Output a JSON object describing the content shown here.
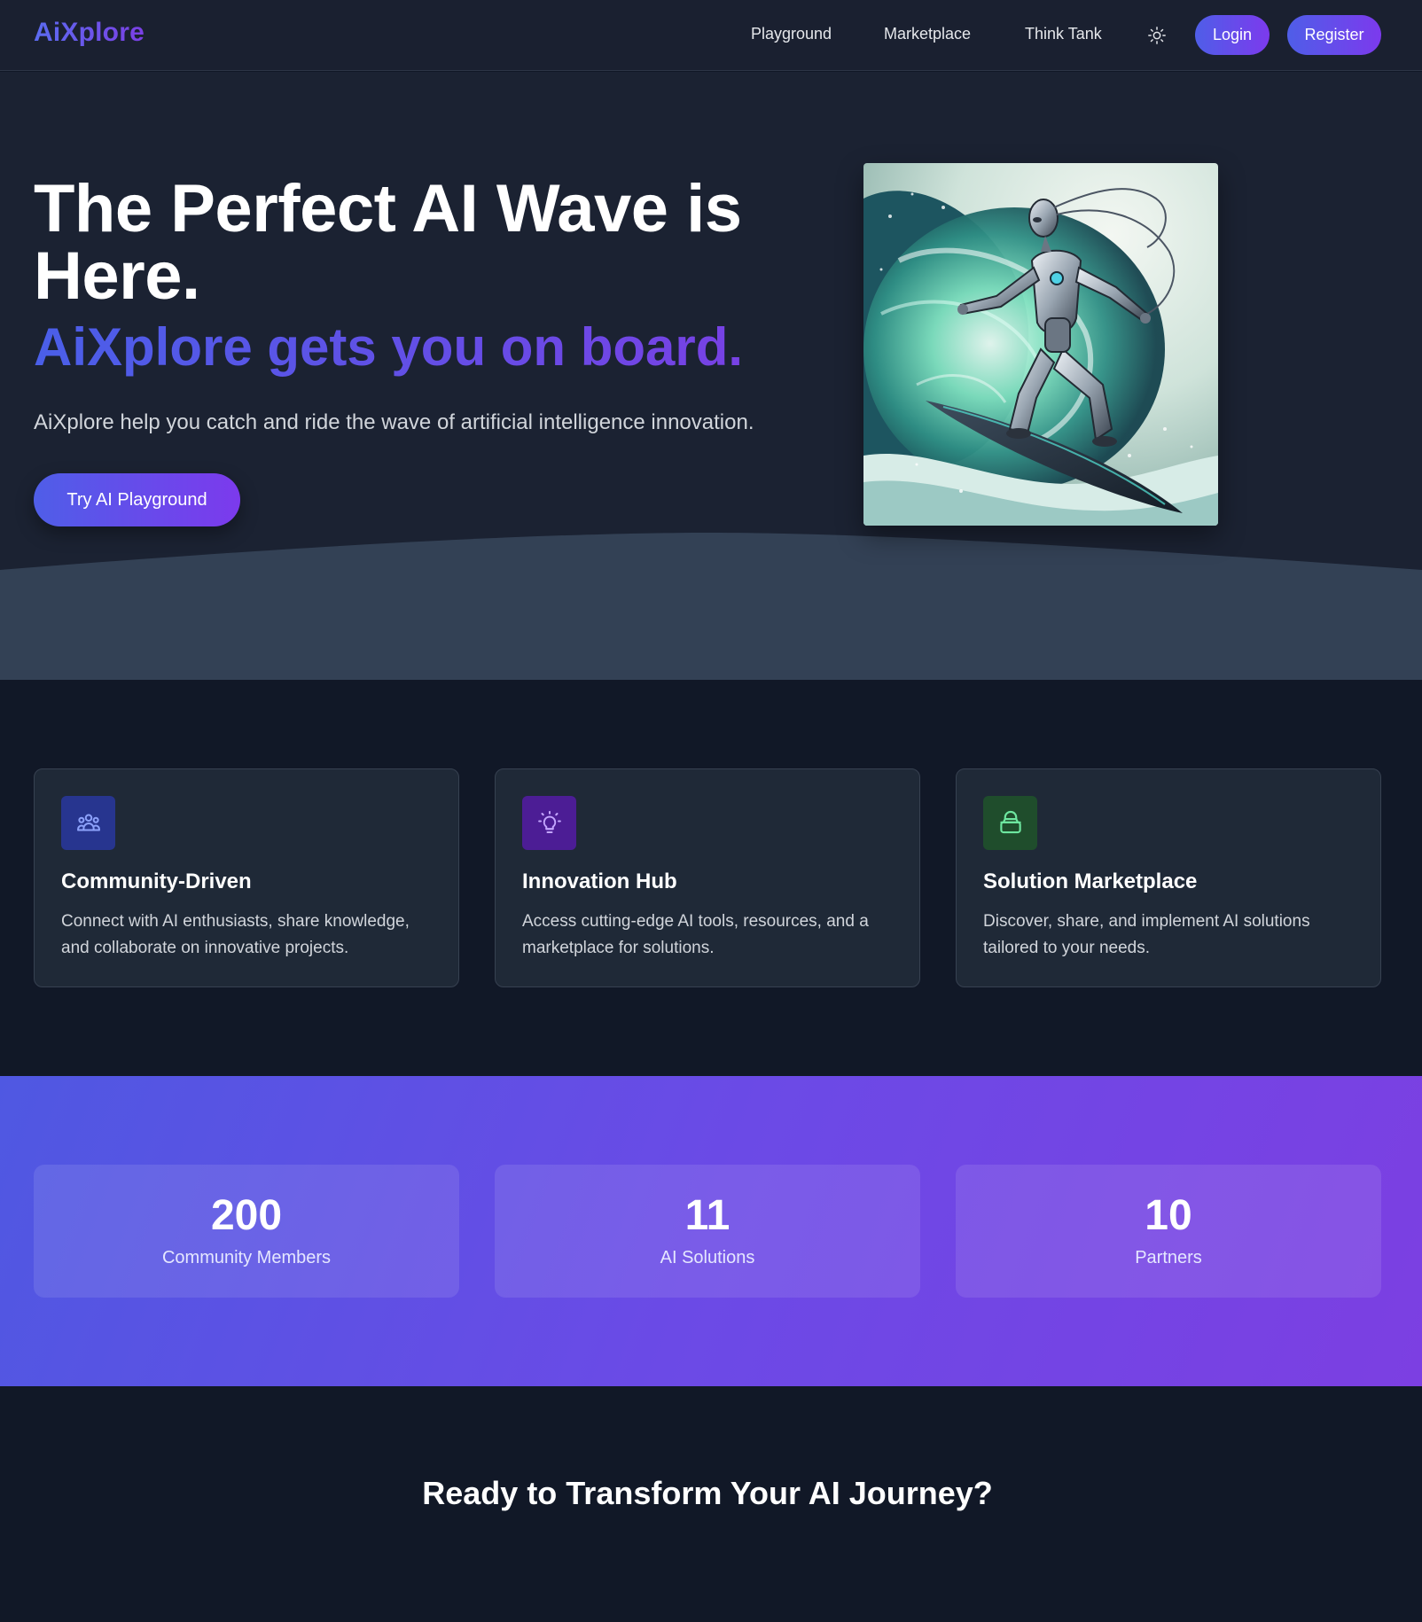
{
  "nav": {
    "logo": "AiXplore",
    "links": [
      "Playground",
      "Marketplace",
      "Think Tank"
    ],
    "theme_icon": "sun-icon",
    "login_label": "Login",
    "register_label": "Register"
  },
  "hero": {
    "title": "The Perfect AI Wave is Here.",
    "subtitle": "AiXplore gets you on board.",
    "description": "AiXplore help you catch and ride the wave of artificial intelligence innovation.",
    "cta_label": "Try AI Playground",
    "image_icon": "robot-surfer-illustration"
  },
  "features": [
    {
      "title": "Community-Driven",
      "description": "Connect with AI enthusiasts, share knowledge, and collaborate on innovative projects.",
      "icon": "users-icon",
      "icon_bg": "#27358f",
      "icon_color": "#8da2fb"
    },
    {
      "title": "Innovation Hub",
      "description": "Access cutting-edge AI tools, resources, and a marketplace for solutions.",
      "icon": "lightbulb-icon",
      "icon_bg": "#4c1d95",
      "icon_color": "#c4a6ff"
    },
    {
      "title": "Solution Marketplace",
      "description": "Discover, share, and implement AI solutions tailored to your needs.",
      "icon": "shopping-bag-icon",
      "icon_bg": "#1f4d2c",
      "icon_color": "#6ee7a0"
    }
  ],
  "stats": [
    {
      "value": "200",
      "label": "Community Members"
    },
    {
      "value": "11",
      "label": "AI Solutions"
    },
    {
      "value": "10",
      "label": "Partners"
    }
  ],
  "bottom_cta": {
    "title": "Ready to Transform Your AI Journey?"
  },
  "colors": {
    "accent_start": "#4f5ee8",
    "accent_end": "#7c3aed",
    "page_bg": "#111827",
    "card_bg": "#1f2937",
    "hero_wave": "#334155"
  }
}
